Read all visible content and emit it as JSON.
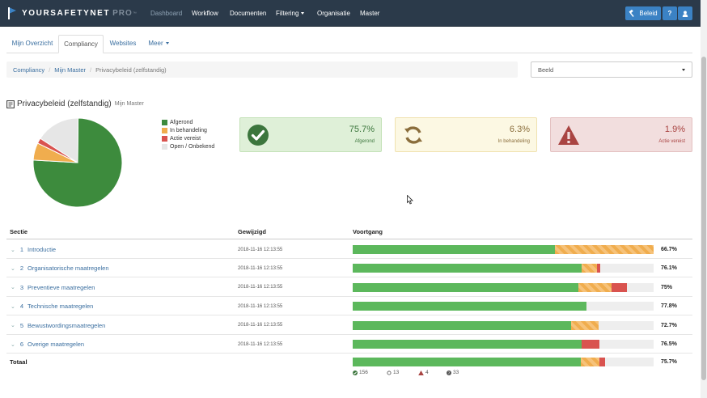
{
  "brand": {
    "name": "YOURSAFETYNET",
    "suffix": "PRO",
    "trademark": "™"
  },
  "nav": {
    "items": [
      "Dashboard",
      "Workflow",
      "Documenten",
      "Filtering",
      "Organisatie",
      "Master"
    ],
    "beleid_label": "Beleid",
    "help_label": "?"
  },
  "tabs": [
    "Mijn Overzicht",
    "Compliancy",
    "Websites",
    "Meer"
  ],
  "breadcrumb": [
    "Compliancy",
    "Mijn Master",
    "Privacybeleid (zelfstandig)"
  ],
  "view_select": {
    "value": "Beeld"
  },
  "page": {
    "title": "Privacybeleid (zelfstandig)",
    "subtitle": "Mijn Master"
  },
  "colors": {
    "green": "#5cb85c",
    "orange": "#f0ad4e",
    "red": "#d9534f",
    "grey": "#e6e6e6",
    "pie_green": "#3d8b3d"
  },
  "legend": [
    "Afgerond",
    "In behandeling",
    "Actie vereist",
    "Open / Onbekend"
  ],
  "stats": [
    {
      "value": "75.7%",
      "label": "Afgerond",
      "icon": "check-circle-icon"
    },
    {
      "value": "6.3%",
      "label": "In behandeling",
      "icon": "refresh-icon"
    },
    {
      "value": "1.9%",
      "label": "Actie vereist",
      "icon": "warning-icon"
    }
  ],
  "chart_data": {
    "type": "pie",
    "categories": [
      "Afgerond",
      "In behandeling",
      "Actie vereist",
      "Open / Onbekend"
    ],
    "values": [
      156,
      13,
      4,
      33
    ]
  },
  "table": {
    "headers": [
      "Sectie",
      "Gewijzigd",
      "Voortgang"
    ],
    "rows": [
      {
        "num": "1",
        "name": "Introductie",
        "date": "2018-11-16 12:13:55",
        "green": 0.672,
        "orange": 0.328,
        "red": 0,
        "pct": "66.7%"
      },
      {
        "num": "2",
        "name": "Organisatorische maatregelen",
        "date": "2018-11-16 12:13:55",
        "green": 0.761,
        "orange": 0.05,
        "red": 0.012,
        "pct": "76.1%"
      },
      {
        "num": "3",
        "name": "Preventieve maatregelen",
        "date": "2018-11-16 12:13:55",
        "green": 0.75,
        "orange": 0.11,
        "red": 0.05,
        "pct": "75%"
      },
      {
        "num": "4",
        "name": "Technische maatregelen",
        "date": "2018-11-16 12:13:55",
        "green": 0.778,
        "orange": 0,
        "red": 0,
        "pct": "77.8%"
      },
      {
        "num": "5",
        "name": "Bewustwordingsmaatregelen",
        "date": "2018-11-16 12:13:55",
        "green": 0.727,
        "orange": 0.09,
        "red": 0,
        "pct": "72.7%"
      },
      {
        "num": "6",
        "name": "Overige maatregelen",
        "date": "2018-11-16 12:13:55",
        "green": 0.76,
        "orange": 0,
        "red": 0.06,
        "pct": "76.5%"
      }
    ],
    "total": {
      "label": "Totaal",
      "green": 0.757,
      "orange": 0.063,
      "red": 0.019,
      "pct": "75.7%"
    },
    "counts": {
      "afgerond": "156",
      "in_behandeling": "13",
      "actie_vereist": "4",
      "open": "33"
    }
  }
}
